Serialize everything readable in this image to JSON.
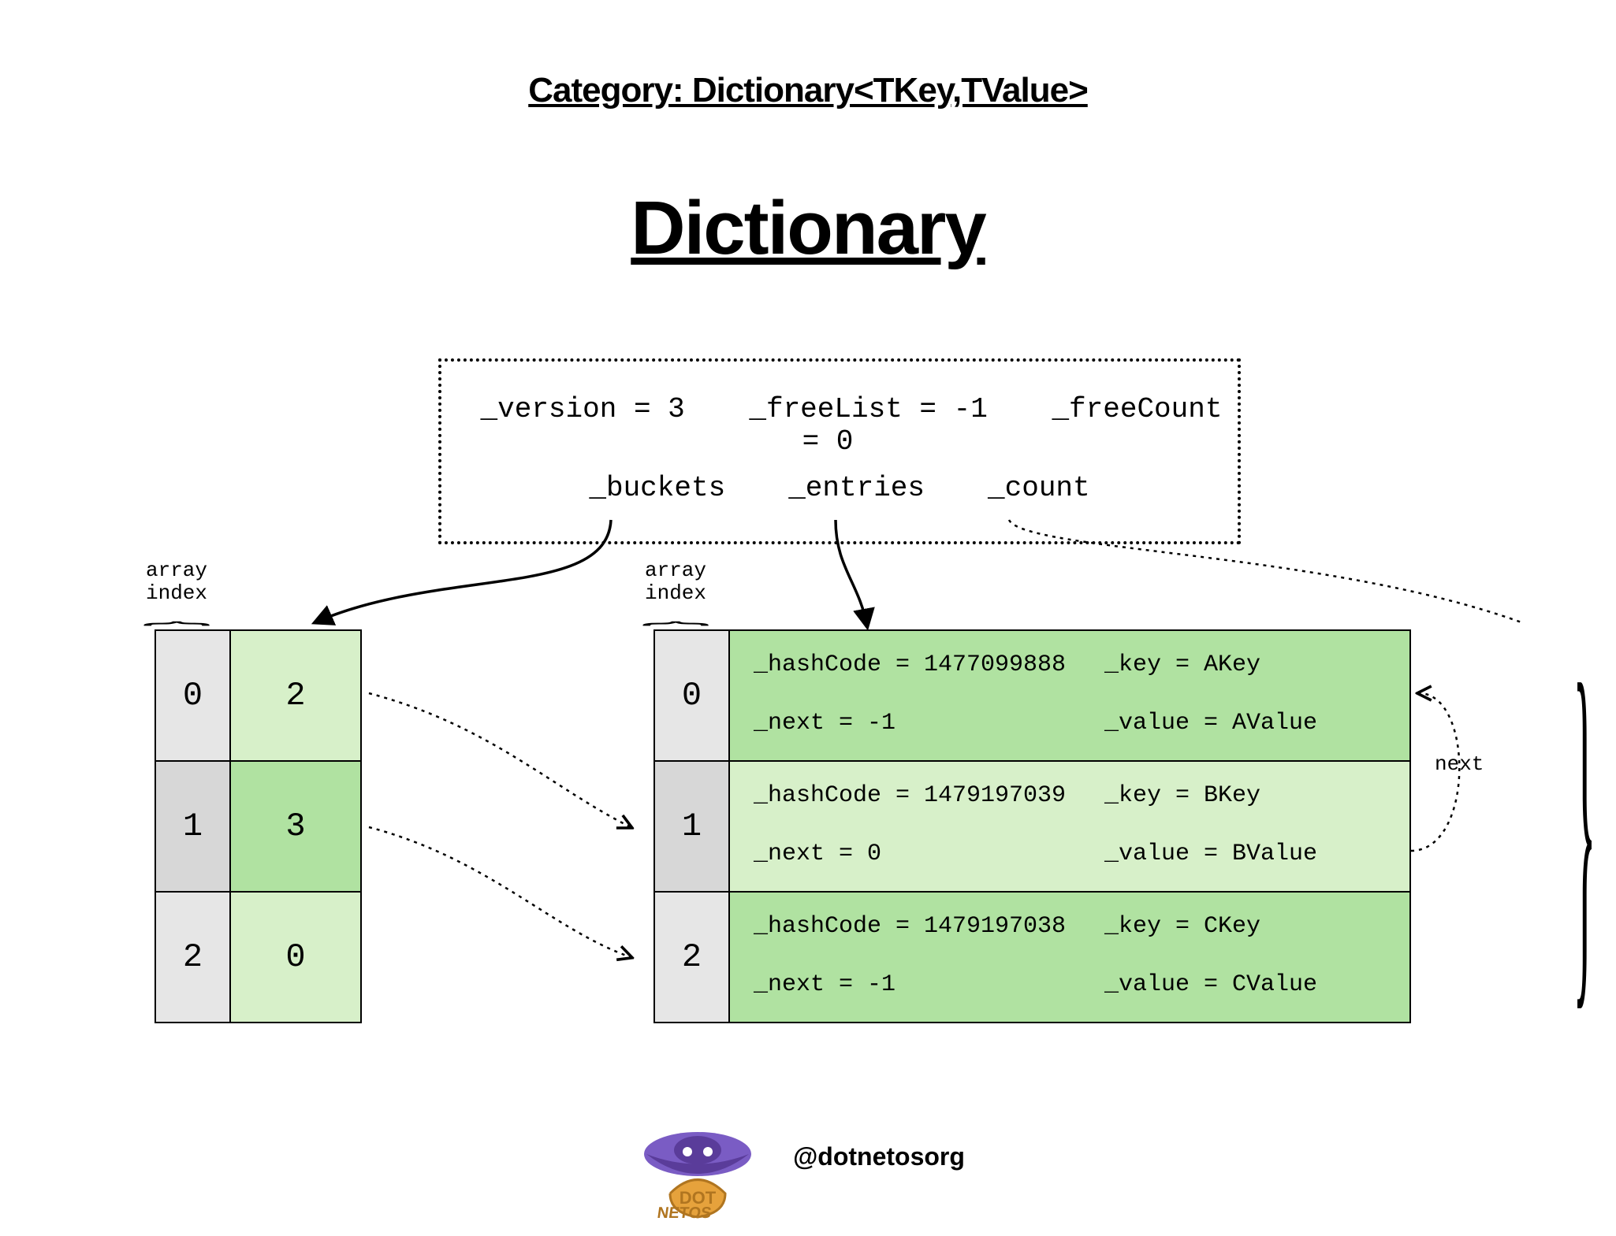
{
  "header": {
    "category": "Category: Dictionary<TKey,TValue>",
    "title": "Dictionary"
  },
  "internals": {
    "version_label": "_version = 3",
    "freeList_label": "_freeList = -1",
    "freeCount_label": "_freeCount = 0",
    "buckets_label": "_buckets",
    "entries_label": "_entries",
    "count_label": "_count"
  },
  "labels": {
    "array_index": "array\nindex",
    "next": "next"
  },
  "colors": {
    "idx_light": "#e6e6e6",
    "idx_dark": "#d7d7d7",
    "green_light": "#d7f0c9",
    "green_dark": "#b0e2a1"
  },
  "buckets": [
    {
      "index": "0",
      "value": "2"
    },
    {
      "index": "1",
      "value": "3"
    },
    {
      "index": "2",
      "value": "0"
    }
  ],
  "entries": [
    {
      "index": "0",
      "hashCode": "_hashCode = 1477099888",
      "next": "_next = -1",
      "key": "_key = AKey",
      "value": "_value = AValue"
    },
    {
      "index": "1",
      "hashCode": "_hashCode = 1479197039",
      "next": "_next = 0",
      "key": "_key = BKey",
      "value": "_value = BValue"
    },
    {
      "index": "2",
      "hashCode": "_hashCode = 1479197038",
      "next": "_next = -1",
      "key": "_key = CKey",
      "value": "_value = CValue"
    }
  ],
  "footer": {
    "handle": "@dotnetosorg"
  }
}
